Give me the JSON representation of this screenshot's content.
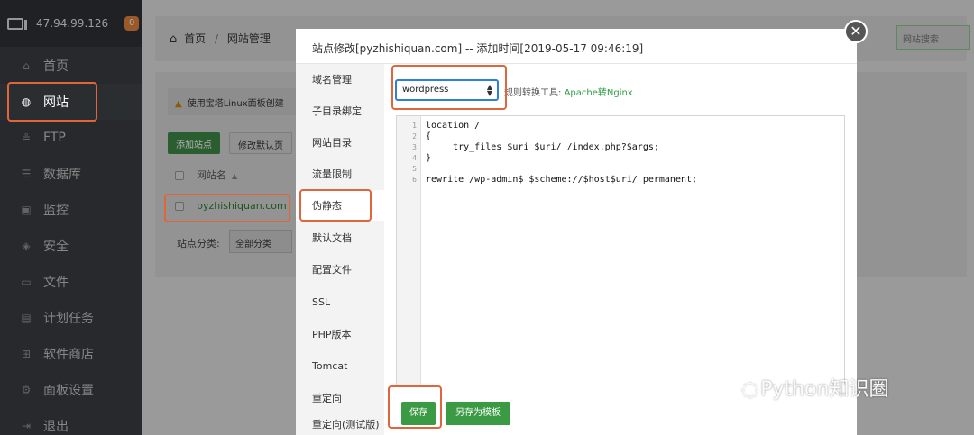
{
  "sidebar": {
    "ip": "47.94.99.126",
    "badge": "0",
    "items": [
      {
        "label": "首页",
        "icon": "home-icon"
      },
      {
        "label": "网站",
        "icon": "globe-icon"
      },
      {
        "label": "FTP",
        "icon": "ftp-icon"
      },
      {
        "label": "数据库",
        "icon": "database-icon"
      },
      {
        "label": "监控",
        "icon": "monitor-icon"
      },
      {
        "label": "安全",
        "icon": "shield-icon"
      },
      {
        "label": "文件",
        "icon": "folder-icon"
      },
      {
        "label": "计划任务",
        "icon": "calendar-icon"
      },
      {
        "label": "软件商店",
        "icon": "grid-icon"
      },
      {
        "label": "面板设置",
        "icon": "gear-icon"
      },
      {
        "label": "退出",
        "icon": "logout-icon"
      }
    ]
  },
  "main": {
    "breadcrumb_home": "首页",
    "breadcrumb_sep": "/",
    "breadcrumb_current": "网站管理",
    "search_placeholder": "网站搜索",
    "warning": "使用宝塔Linux面板创建",
    "add_site": "添加站点",
    "modify_default": "修改默认页",
    "col_site_name": "网站名",
    "site_name": "pyzhishiquan.com",
    "category_label": "站点分类:",
    "category_value": "全部分类"
  },
  "modal": {
    "title": "站点修改[pyzhishiquan.com] -- 添加时间[2019-05-17 09:46:19]",
    "nav": [
      "域名管理",
      "子目录绑定",
      "网站目录",
      "流量限制",
      "伪静态",
      "默认文档",
      "配置文件",
      "SSL",
      "PHP版本",
      "Tomcat",
      "重定向",
      "重定向(测试版)"
    ],
    "active_nav": "伪静态",
    "select_value": "wordpress",
    "rule_tip_prefix": "规则转换工具:",
    "rule_tip_link": "Apache转Nginx",
    "code_lines": [
      {
        "n": "1",
        "text": "location /"
      },
      {
        "n": "2",
        "text": "{"
      },
      {
        "n": "3",
        "text": "     try_files $uri $uri/ /index.php?$args;"
      },
      {
        "n": "4",
        "text": "}"
      },
      {
        "n": "5",
        "text": ""
      },
      {
        "n": "6",
        "text": "rewrite /wp-admin$ $scheme://$host$uri/ permanent;"
      }
    ],
    "save_label": "保存",
    "save_template_label": "另存为模板"
  },
  "watermark": "Python知识圈",
  "colors": {
    "highlight": "#e0653a",
    "accent_green": "#3b9a44",
    "select_border": "#2f7fd9"
  }
}
